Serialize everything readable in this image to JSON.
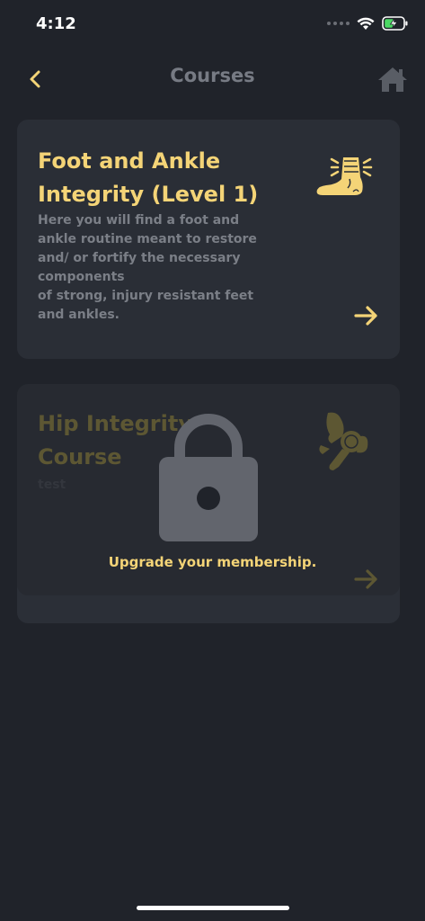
{
  "status_bar": {
    "time": "4:12"
  },
  "header": {
    "title": "Courses",
    "back_icon": "chevron-left-icon",
    "home_icon": "home-icon"
  },
  "courses": [
    {
      "title": "Foot and Ankle Integrity (Level 1)",
      "description": "Here you will find a foot and ankle routine meant to restore and/ or fortify the necessary components\n of strong, injury resistant feet and ankles.",
      "icon": "foot-ankle-icon",
      "locked": false
    },
    {
      "title": "Hip Integrity Course",
      "description": "test",
      "icon": "hip-joint-icon",
      "locked": true
    }
  ],
  "lock_overlay": {
    "message": "Upgrade your membership.",
    "icon": "lock-icon"
  },
  "colors": {
    "background": "#20232a",
    "card": "#2a2e36",
    "accent": "#f4d477",
    "muted_text": "#7b7f87",
    "header_text": "#777b84",
    "lock_gray": "#62656d"
  }
}
